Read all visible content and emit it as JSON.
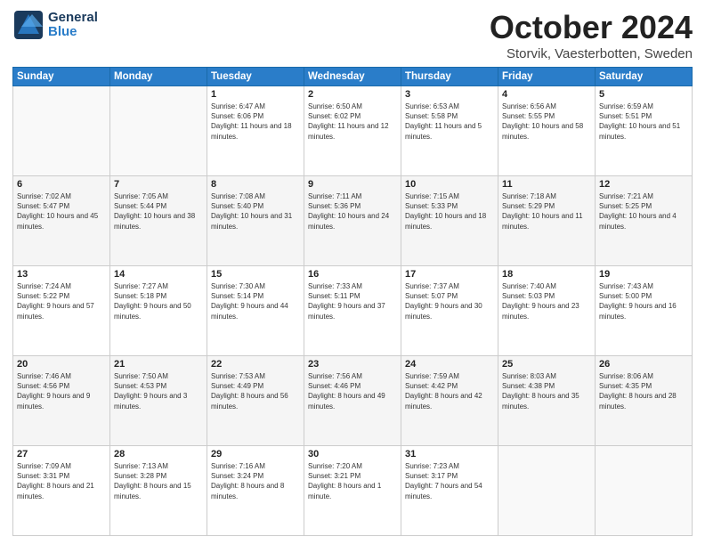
{
  "header": {
    "logo": {
      "general": "General",
      "blue": "Blue"
    },
    "title": "October 2024",
    "subtitle": "Storvik, Vaesterbotten, Sweden"
  },
  "weekdays": [
    "Sunday",
    "Monday",
    "Tuesday",
    "Wednesday",
    "Thursday",
    "Friday",
    "Saturday"
  ],
  "weeks": [
    [
      {
        "day": "",
        "sunrise": "",
        "sunset": "",
        "daylight": ""
      },
      {
        "day": "",
        "sunrise": "",
        "sunset": "",
        "daylight": ""
      },
      {
        "day": "1",
        "sunrise": "Sunrise: 6:47 AM",
        "sunset": "Sunset: 6:06 PM",
        "daylight": "Daylight: 11 hours and 18 minutes."
      },
      {
        "day": "2",
        "sunrise": "Sunrise: 6:50 AM",
        "sunset": "Sunset: 6:02 PM",
        "daylight": "Daylight: 11 hours and 12 minutes."
      },
      {
        "day": "3",
        "sunrise": "Sunrise: 6:53 AM",
        "sunset": "Sunset: 5:58 PM",
        "daylight": "Daylight: 11 hours and 5 minutes."
      },
      {
        "day": "4",
        "sunrise": "Sunrise: 6:56 AM",
        "sunset": "Sunset: 5:55 PM",
        "daylight": "Daylight: 10 hours and 58 minutes."
      },
      {
        "day": "5",
        "sunrise": "Sunrise: 6:59 AM",
        "sunset": "Sunset: 5:51 PM",
        "daylight": "Daylight: 10 hours and 51 minutes."
      }
    ],
    [
      {
        "day": "6",
        "sunrise": "Sunrise: 7:02 AM",
        "sunset": "Sunset: 5:47 PM",
        "daylight": "Daylight: 10 hours and 45 minutes."
      },
      {
        "day": "7",
        "sunrise": "Sunrise: 7:05 AM",
        "sunset": "Sunset: 5:44 PM",
        "daylight": "Daylight: 10 hours and 38 minutes."
      },
      {
        "day": "8",
        "sunrise": "Sunrise: 7:08 AM",
        "sunset": "Sunset: 5:40 PM",
        "daylight": "Daylight: 10 hours and 31 minutes."
      },
      {
        "day": "9",
        "sunrise": "Sunrise: 7:11 AM",
        "sunset": "Sunset: 5:36 PM",
        "daylight": "Daylight: 10 hours and 24 minutes."
      },
      {
        "day": "10",
        "sunrise": "Sunrise: 7:15 AM",
        "sunset": "Sunset: 5:33 PM",
        "daylight": "Daylight: 10 hours and 18 minutes."
      },
      {
        "day": "11",
        "sunrise": "Sunrise: 7:18 AM",
        "sunset": "Sunset: 5:29 PM",
        "daylight": "Daylight: 10 hours and 11 minutes."
      },
      {
        "day": "12",
        "sunrise": "Sunrise: 7:21 AM",
        "sunset": "Sunset: 5:25 PM",
        "daylight": "Daylight: 10 hours and 4 minutes."
      }
    ],
    [
      {
        "day": "13",
        "sunrise": "Sunrise: 7:24 AM",
        "sunset": "Sunset: 5:22 PM",
        "daylight": "Daylight: 9 hours and 57 minutes."
      },
      {
        "day": "14",
        "sunrise": "Sunrise: 7:27 AM",
        "sunset": "Sunset: 5:18 PM",
        "daylight": "Daylight: 9 hours and 50 minutes."
      },
      {
        "day": "15",
        "sunrise": "Sunrise: 7:30 AM",
        "sunset": "Sunset: 5:14 PM",
        "daylight": "Daylight: 9 hours and 44 minutes."
      },
      {
        "day": "16",
        "sunrise": "Sunrise: 7:33 AM",
        "sunset": "Sunset: 5:11 PM",
        "daylight": "Daylight: 9 hours and 37 minutes."
      },
      {
        "day": "17",
        "sunrise": "Sunrise: 7:37 AM",
        "sunset": "Sunset: 5:07 PM",
        "daylight": "Daylight: 9 hours and 30 minutes."
      },
      {
        "day": "18",
        "sunrise": "Sunrise: 7:40 AM",
        "sunset": "Sunset: 5:03 PM",
        "daylight": "Daylight: 9 hours and 23 minutes."
      },
      {
        "day": "19",
        "sunrise": "Sunrise: 7:43 AM",
        "sunset": "Sunset: 5:00 PM",
        "daylight": "Daylight: 9 hours and 16 minutes."
      }
    ],
    [
      {
        "day": "20",
        "sunrise": "Sunrise: 7:46 AM",
        "sunset": "Sunset: 4:56 PM",
        "daylight": "Daylight: 9 hours and 9 minutes."
      },
      {
        "day": "21",
        "sunrise": "Sunrise: 7:50 AM",
        "sunset": "Sunset: 4:53 PM",
        "daylight": "Daylight: 9 hours and 3 minutes."
      },
      {
        "day": "22",
        "sunrise": "Sunrise: 7:53 AM",
        "sunset": "Sunset: 4:49 PM",
        "daylight": "Daylight: 8 hours and 56 minutes."
      },
      {
        "day": "23",
        "sunrise": "Sunrise: 7:56 AM",
        "sunset": "Sunset: 4:46 PM",
        "daylight": "Daylight: 8 hours and 49 minutes."
      },
      {
        "day": "24",
        "sunrise": "Sunrise: 7:59 AM",
        "sunset": "Sunset: 4:42 PM",
        "daylight": "Daylight: 8 hours and 42 minutes."
      },
      {
        "day": "25",
        "sunrise": "Sunrise: 8:03 AM",
        "sunset": "Sunset: 4:38 PM",
        "daylight": "Daylight: 8 hours and 35 minutes."
      },
      {
        "day": "26",
        "sunrise": "Sunrise: 8:06 AM",
        "sunset": "Sunset: 4:35 PM",
        "daylight": "Daylight: 8 hours and 28 minutes."
      }
    ],
    [
      {
        "day": "27",
        "sunrise": "Sunrise: 7:09 AM",
        "sunset": "Sunset: 3:31 PM",
        "daylight": "Daylight: 8 hours and 21 minutes."
      },
      {
        "day": "28",
        "sunrise": "Sunrise: 7:13 AM",
        "sunset": "Sunset: 3:28 PM",
        "daylight": "Daylight: 8 hours and 15 minutes."
      },
      {
        "day": "29",
        "sunrise": "Sunrise: 7:16 AM",
        "sunset": "Sunset: 3:24 PM",
        "daylight": "Daylight: 8 hours and 8 minutes."
      },
      {
        "day": "30",
        "sunrise": "Sunrise: 7:20 AM",
        "sunset": "Sunset: 3:21 PM",
        "daylight": "Daylight: 8 hours and 1 minute."
      },
      {
        "day": "31",
        "sunrise": "Sunrise: 7:23 AM",
        "sunset": "Sunset: 3:17 PM",
        "daylight": "Daylight: 7 hours and 54 minutes."
      },
      {
        "day": "",
        "sunrise": "",
        "sunset": "",
        "daylight": ""
      },
      {
        "day": "",
        "sunrise": "",
        "sunset": "",
        "daylight": ""
      }
    ]
  ]
}
